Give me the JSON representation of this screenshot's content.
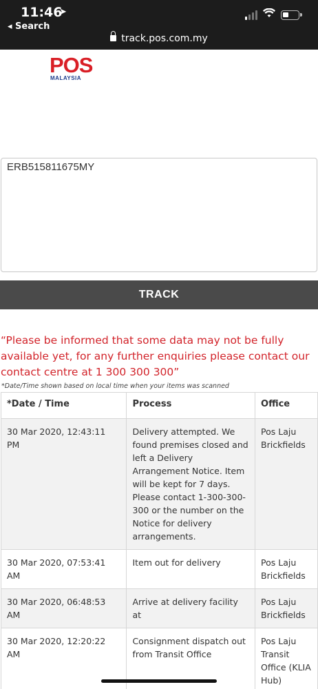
{
  "status_bar": {
    "time": "11:46",
    "back_label": "◂ Search",
    "url": "track.pos.com.my"
  },
  "logo": {
    "word": "POS",
    "sub": "MALAYSIA"
  },
  "tracking_input": {
    "value": "ERB515811675MY"
  },
  "track_button": {
    "label": "TRACK"
  },
  "notice": "“Please be informed that some data may not be fully available yet, for any further enquiries please contact our contact centre at 1 300 300 300”",
  "footnote": "*Date/Time shown based on local time when your items was scanned",
  "table": {
    "headers": [
      "*Date / Time",
      "Process",
      "Office"
    ],
    "rows": [
      {
        "datetime": "30 Mar 2020, 12:43:11 PM",
        "process": "Delivery attempted. We found premises closed and left a Delivery Arrangement Notice. Item will be kept for 7 days. Please contact 1-300-300-300 or the number on the Notice for delivery arrangements.",
        "office": "Pos Laju Brickfields"
      },
      {
        "datetime": "30 Mar 2020, 07:53:41 AM",
        "process": "Item out for delivery",
        "office": "Pos Laju Brickfields"
      },
      {
        "datetime": "30 Mar 2020, 06:48:53 AM",
        "process": "Arrive at delivery facility at",
        "office": "Pos Laju Brickfields"
      },
      {
        "datetime": "30 Mar 2020, 12:20:22 AM",
        "process": "Consignment dispatch out from Transit Office",
        "office": "Pos Laju Transit Office (KLIA Hub)"
      }
    ]
  },
  "colors": {
    "brand_red": "#d91f26",
    "brand_blue": "#1f3e8c",
    "notice_red": "#d2232a",
    "button_bg": "#4a4a4a"
  }
}
